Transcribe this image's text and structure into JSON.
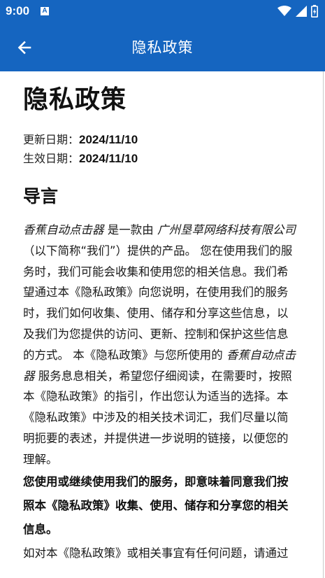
{
  "status_bar": {
    "time": "9:00",
    "notification_icon": "A",
    "icons": [
      "wifi-icon",
      "signal-icon",
      "battery-icon"
    ]
  },
  "app_bar": {
    "title": "隐私政策",
    "back_icon": "arrow-left-icon"
  },
  "colors": {
    "primary": "#1565c0",
    "text": "#111111",
    "background": "#ffffff"
  },
  "document": {
    "title": "隐私政策",
    "updated_label": "更新日期：",
    "updated_date": "2024/11/10",
    "effective_label": "生效日期：",
    "effective_date": "2024/11/10",
    "section_title": "导言",
    "intro": {
      "app_name": "香蕉自动点击器",
      "t1": " 是一款由 ",
      "company": "广州垦草网络科技有限公司",
      "t2": " （以下简称“我们”）提供的产品。 您在使用我们的服务时，我们可能会收集和使用您的相关信息。我们希望通过本《隐私政策》向您说明，在使用我们的服务时，我们如何收集、使用、储存和分享这些信息，以及我们为您提供的访问、更新、控制和保护这些信息的方式。 本《隐私政策》与您所使用的 ",
      "app_name2": "香蕉自动点击器",
      "t3": " 服务息息相关，希望您仔细阅读，在需要时，按照本《隐私政策》的指引，作出您认为适当的选择。本《隐私政策》中涉及的相关技术词汇，我们尽量以简明扼要的表述，并提供进一步说明的链接，以便您的理解。"
    },
    "consent": "您使用或继续使用我们的服务，即意味着同意我们按照本《隐私政策》收集、使用、储存和分享您的相关信息。",
    "contact": "如对本《隐私政策》或相关事宜有任何问题，请通过"
  }
}
